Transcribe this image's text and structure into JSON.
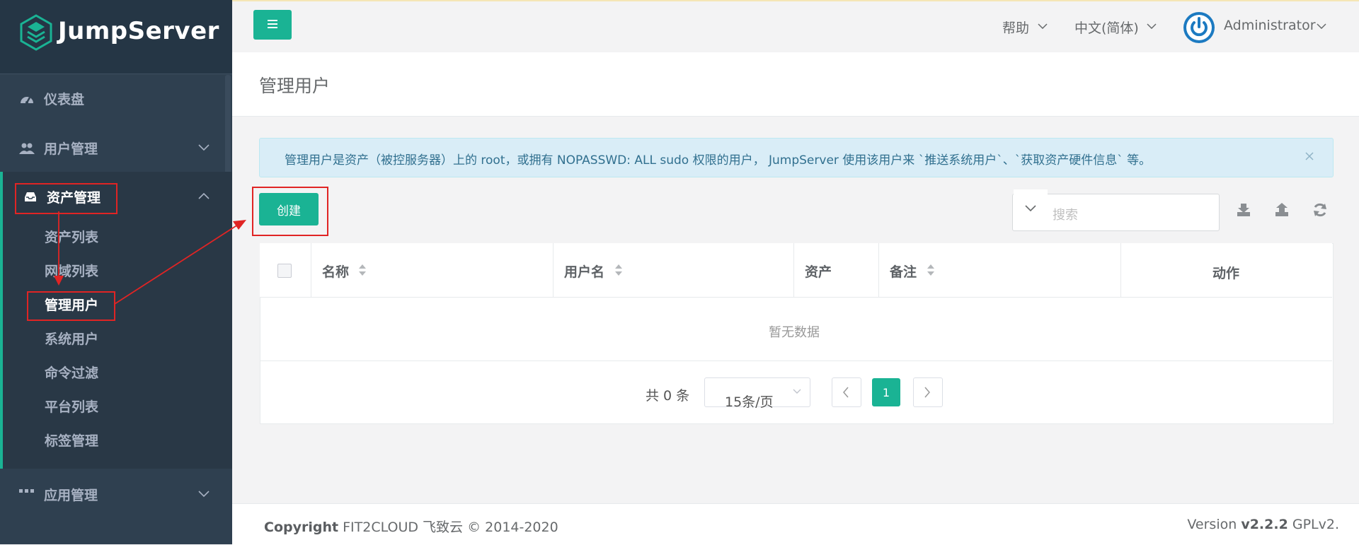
{
  "sidebar": {
    "logo_text": "JumpServer",
    "items": [
      {
        "label": "仪表盘",
        "icon": "dashboard-icon"
      },
      {
        "label": "用户管理",
        "icon": "users-icon"
      },
      {
        "label": "资产管理",
        "icon": "inbox-icon"
      },
      {
        "label": "应用管理",
        "icon": "apps-icon"
      }
    ],
    "submenu": [
      {
        "label": "资产列表"
      },
      {
        "label": "网域列表"
      },
      {
        "label": "管理用户"
      },
      {
        "label": "系统用户"
      },
      {
        "label": "命令过滤"
      },
      {
        "label": "平台列表"
      },
      {
        "label": "标签管理"
      }
    ]
  },
  "topbar": {
    "help": "帮助",
    "language": "中文(简体)",
    "user": "Administrator"
  },
  "page": {
    "title": "管理用户"
  },
  "alert": {
    "text": "管理用户是资产（被控服务器）上的 root，或拥有 NOPASSWD: ALL sudo 权限的用户， JumpServer 使用该用户来 `推送系统用户`、`获取资产硬件信息` 等。"
  },
  "toolbar": {
    "create_label": "创建",
    "search_placeholder": "搜索"
  },
  "table": {
    "columns": [
      "名称",
      "用户名",
      "资产",
      "备注",
      "动作"
    ],
    "empty_text": "暂无数据"
  },
  "pagination": {
    "total": "共 0 条",
    "page_size": "15条/页",
    "current_page": "1"
  },
  "footer": {
    "copyright_label": "Copyright",
    "copyright_text": "FIT2CLOUD 飞致云 © 2014-2020",
    "version_label": "Version",
    "version_number": "v2.2.2",
    "license": "GPLv2."
  },
  "colors": {
    "accent": "#1ab394",
    "sidebar_bg": "#2f4050",
    "annotation_red": "#e02424",
    "alert_bg": "#d9edf7"
  }
}
